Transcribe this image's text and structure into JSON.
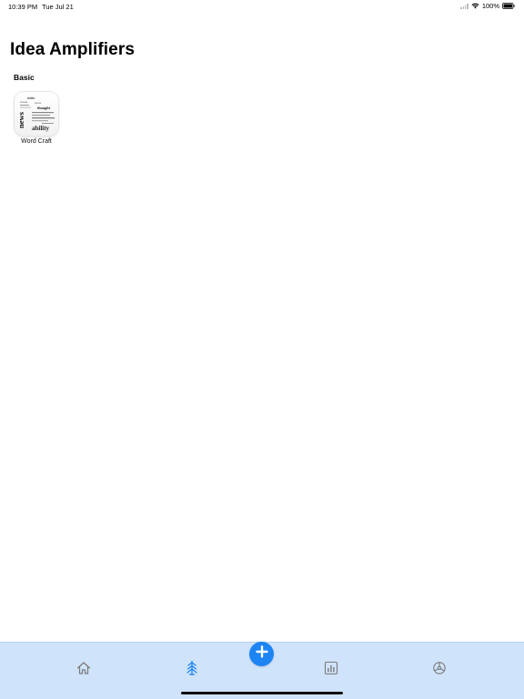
{
  "status_bar": {
    "time": "10:39 PM",
    "date": "Tue Jul 21",
    "battery_percent": "100%"
  },
  "page": {
    "title": "Idea Amplifiers"
  },
  "sections": [
    {
      "header": "Basic",
      "apps": [
        {
          "label": "Word Craft",
          "icon": "word-cloud-icon",
          "icon_words": [
            "news",
            "ability",
            "thought",
            "ideas",
            "write",
            "create"
          ]
        }
      ]
    }
  ],
  "tab_bar": {
    "items": [
      {
        "icon": "home-icon",
        "selected": false
      },
      {
        "icon": "amplifier-icon",
        "selected": true
      },
      {
        "icon": "add-icon",
        "selected": false
      },
      {
        "icon": "chart-icon",
        "selected": false
      },
      {
        "icon": "settings-icon",
        "selected": false
      }
    ],
    "colors": {
      "background": "#cfe3fb",
      "accent": "#1d84f3",
      "inactive": "#7a7a7a"
    }
  }
}
